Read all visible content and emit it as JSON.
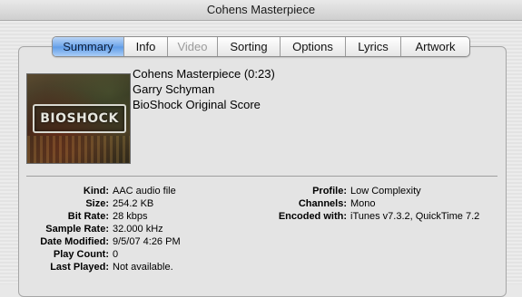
{
  "window": {
    "title": "Cohens Masterpiece"
  },
  "tabs": [
    {
      "label": "Summary",
      "state": "active"
    },
    {
      "label": "Info",
      "state": "normal"
    },
    {
      "label": "Video",
      "state": "disabled"
    },
    {
      "label": "Sorting",
      "state": "normal"
    },
    {
      "label": "Options",
      "state": "normal"
    },
    {
      "label": "Lyrics",
      "state": "normal"
    },
    {
      "label": "Artwork",
      "state": "normal"
    }
  ],
  "artwork": {
    "logo_text": "BIOSHOCK"
  },
  "track": {
    "title_line": "Cohens Masterpiece (0:23)",
    "artist": "Garry Schyman",
    "album": "BioShock Original Score"
  },
  "details_left": [
    {
      "label": "Kind:",
      "value": "AAC audio file"
    },
    {
      "label": "Size:",
      "value": "254.2 KB"
    },
    {
      "label": "Bit Rate:",
      "value": "28 kbps"
    },
    {
      "label": "Sample Rate:",
      "value": "32.000 kHz"
    },
    {
      "label": "Date Modified:",
      "value": "9/5/07 4:26 PM"
    },
    {
      "label": "Play Count:",
      "value": "0"
    },
    {
      "label": "Last Played:",
      "value": "Not available."
    }
  ],
  "details_right": [
    {
      "label": "Profile:",
      "value": "Low Complexity"
    },
    {
      "label": "Channels:",
      "value": "Mono"
    },
    {
      "label": "Encoded with:",
      "value": "iTunes v7.3.2, QuickTime 7.2"
    }
  ]
}
